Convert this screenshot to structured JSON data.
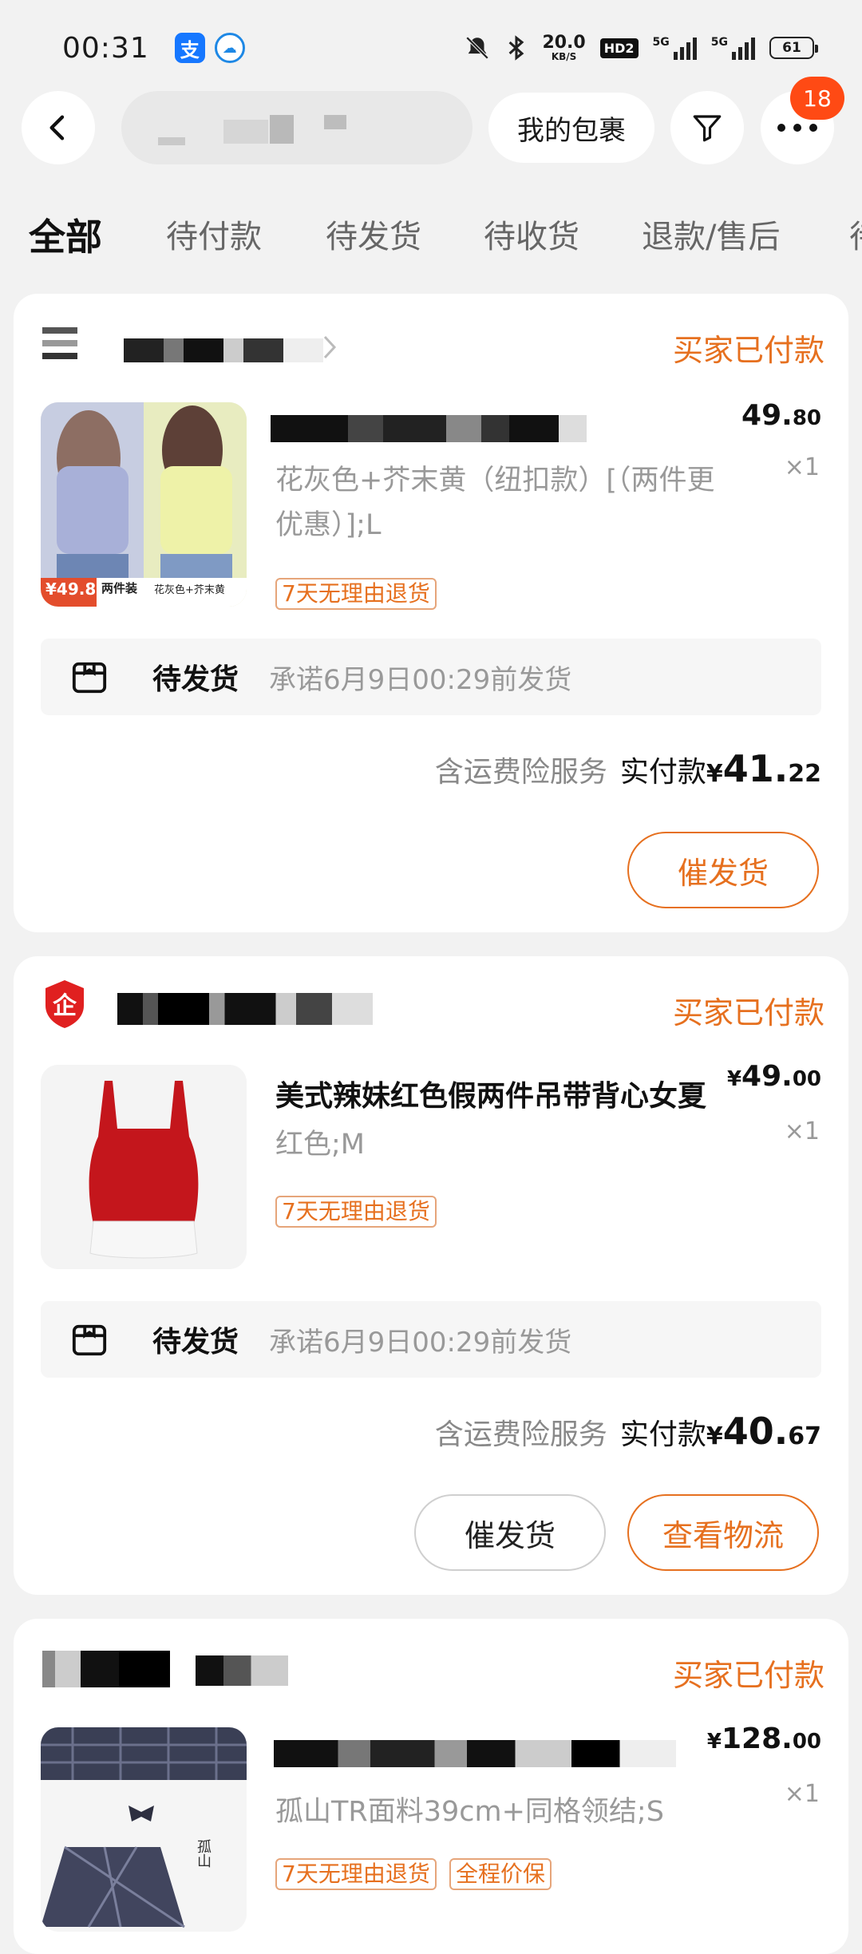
{
  "status_bar": {
    "time": "00:31",
    "alipay_glyph": "支",
    "net_speed_value": "20.0",
    "net_speed_unit": "KB/S",
    "hd_label": "HD2",
    "sim1_label": "5G",
    "sim2_label": "5G",
    "battery": "61"
  },
  "navbar": {
    "my_packages": "我的包裹",
    "badge_count": "18"
  },
  "tabs": [
    {
      "label": "全部"
    },
    {
      "label": "待付款"
    },
    {
      "label": "待发货"
    },
    {
      "label": "待收货"
    },
    {
      "label": "退款/售后"
    },
    {
      "label": "待"
    }
  ],
  "orders": [
    {
      "status": "买家已付款",
      "spec": "花灰色+芥末黄（纽扣款）[（两件更优惠）];L",
      "tags": [
        "7天无理由退货"
      ],
      "price_int": "49.",
      "price_dec": "80",
      "qty": "×1",
      "ship_status": "待发货",
      "ship_promise": "承诺6月9日00:29前发货",
      "insurance": "含运费险服务",
      "paid_label": "实付款",
      "currency": "¥",
      "paid_int": "41.",
      "paid_dec": "22",
      "buttons": [
        "催发货"
      ],
      "img_label_left": "两件装",
      "img_label_right": "花灰色+芥末黄",
      "img_price": "¥49.8"
    },
    {
      "status": "买家已付款",
      "title": "美式辣妹红色假两件吊带背心女夏",
      "spec": "红色;M",
      "tags": [
        "7天无理由退货"
      ],
      "currency": "¥",
      "price_int": "49.",
      "price_dec": "00",
      "qty": "×1",
      "ship_status": "待发货",
      "ship_promise": "承诺6月9日00:29前发货",
      "insurance": "含运费险服务",
      "paid_label": "实付款",
      "paid_int": "40.",
      "paid_dec": "67",
      "buttons": [
        "催发货",
        "查看物流"
      ],
      "shop_icon_glyph": "企"
    },
    {
      "status": "买家已付款",
      "spec": "孤山TR面料39cm+同格领结;S",
      "tags": [
        "7天无理由退货",
        "全程价保"
      ],
      "currency": "¥",
      "price_int": "128.",
      "price_dec": "00",
      "qty": "×1",
      "img_label": "孤山"
    }
  ],
  "colors": {
    "accent": "#e6701f",
    "badge": "#ff4a14",
    "background": "#f2f2f2"
  }
}
